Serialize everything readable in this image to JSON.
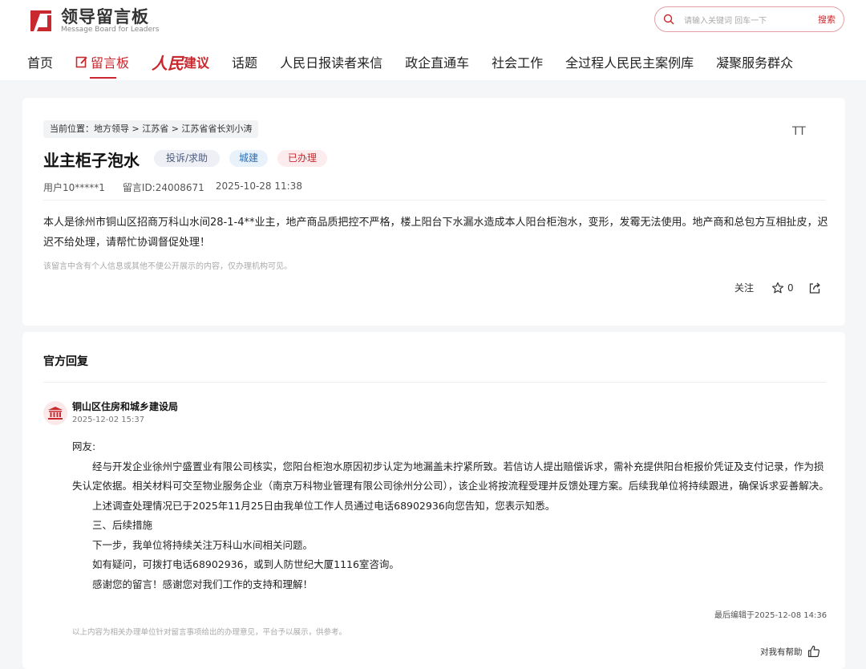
{
  "header": {
    "logo_cn": "领导留言板",
    "logo_en": "Message Board for Leaders",
    "search_placeholder": "请输入关键词 回车一下",
    "search_button": "搜索"
  },
  "nav": {
    "items": [
      "首页",
      "留言板",
      "人民建议",
      "话题",
      "人民日报读者来信",
      "政企直通车",
      "社会工作",
      "全过程人民民主案例库",
      "凝聚服务群众"
    ],
    "jy_part1": "人民",
    "jy_part2": "建议",
    "accent_color": "#c8282e"
  },
  "message": {
    "breadcrumb": "当前位置：地方领导 > 江苏省 > 江苏省省长刘小涛",
    "font_toggle": "TT",
    "title": "业主柜子泡水",
    "tags": [
      "投诉/求助",
      "城建",
      "已办理"
    ],
    "user": "用户10*****1",
    "message_id": "留言ID:24008671",
    "datetime": "2025-10-28 11:38",
    "content": "本人是徐州市铜山区招商万科山水间28-1-4**业主，地产商品质把控不严格，楼上阳台下水漏水造成本人阳台柜泡水，变形，发霉无法使用。地产商和总包方互相扯皮，迟迟不给处理，请帮忙协调督促处理！",
    "privacy_note": "该留言中含有个人信息或其他不便公开展示的内容，仅办理机构可见。",
    "follow_label": "关注",
    "star_count": "0"
  },
  "official_reply": {
    "section_title": "官方回复",
    "org_name": "铜山区住房和城乡建设局",
    "reply_date": "2025-12-02 15:37",
    "greeting": "网友:",
    "paragraphs": [
      "经与开发企业徐州宁盛置业有限公司核实，您阳台柜泡水原因初步认定为地漏盖未拧紧所致。若信访人提出赔偿诉求，需补充提供阳台柜报价凭证及支付记录，作为损失认定依据。相关材料可交至物业服务企业（南京万科物业管理有限公司徐州分公司），该企业将按流程受理并反馈处理方案。后续我单位将持续跟进，确保诉求妥善解决。",
      "上述调查处理情况已于2025年11月25日由我单位工作人员通过电话68902936向您告知，您表示知悉。",
      "三、后续措施",
      "下一步，我单位将持续关注万科山水间相关问题。",
      "如有疑问，可拨打电话68902936，或到人防世纪大厦1116室咨询。",
      "感谢您的留言！感谢您对我们工作的支持和理解！"
    ],
    "last_edited": "最后编辑于2025-12-08 14:36",
    "disclaimer": "以上内容为相关办理单位针对留言事项给出的办理意见，平台予以展示，供参考。",
    "helpful_label": "对我有帮助"
  }
}
